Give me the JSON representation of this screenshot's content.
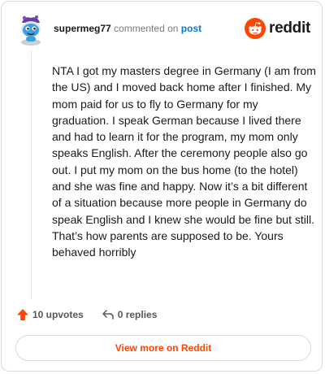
{
  "comment": {
    "author": "supermeg77",
    "action_text": "commented on",
    "post_link_text": "post",
    "body": "NTA I got my masters degree in Germany (I am from the US) and I moved back home after I finished. My mom paid for us to fly to Germany for my graduation. I speak German because I lived there and had to learn it for the program, my mom only speaks English. After the ceremony people also go out. I put my mom on the bus home (to the hotel) and she was fine and happy. Now it’s a bit different of a situation because more people in Germany do speak English and I knew she would be fine but still. That’s how parents are supposed to be. Yours behaved horribly"
  },
  "brand": {
    "name": "reddit",
    "icon": "reddit-snoo-icon",
    "color": "#ff4500"
  },
  "avatar": {
    "icon": "snoo-avatar"
  },
  "actions": {
    "upvotes_label": "10 upvotes",
    "upvote_icon": "upvote-arrow-icon",
    "replies_label": "0 replies",
    "reply_icon": "reply-arrow-icon"
  },
  "footer": {
    "view_more_label": "View more on Reddit"
  }
}
